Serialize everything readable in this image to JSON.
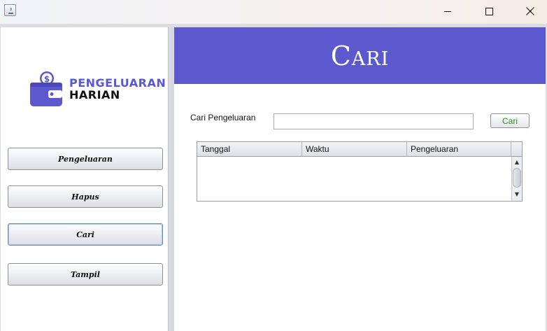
{
  "window": {
    "icon": "java-app-icon",
    "controls": [
      "minimize-icon",
      "maximize-icon",
      "close-icon"
    ]
  },
  "logo": {
    "line1": "PENGELUARAN",
    "line2": "HARIAN",
    "icon": "wallet-dollar-icon",
    "accent_color": "#5b59cd"
  },
  "nav": {
    "items": [
      {
        "label": "Pengeluaran"
      },
      {
        "label": "Hapus"
      },
      {
        "label": "Cari"
      },
      {
        "label": "Tampil"
      }
    ]
  },
  "header": {
    "title": "Cari",
    "bg_color": "#5b59cd"
  },
  "search": {
    "label": "Cari Pengeluaran",
    "value": "",
    "button_label": "Cari",
    "button_color": "#2f8a1d"
  },
  "table": {
    "columns": [
      "Tanggal",
      "Waktu",
      "Pengeluaran"
    ],
    "rows": []
  }
}
